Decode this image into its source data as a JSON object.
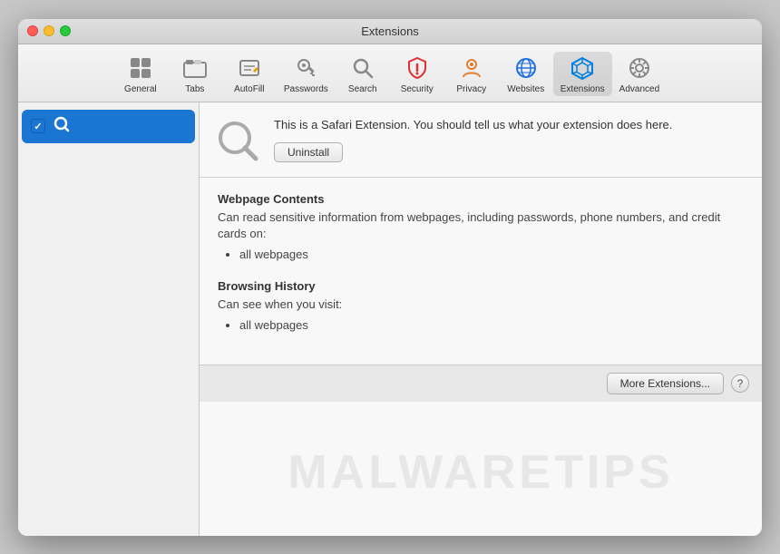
{
  "window": {
    "title": "Extensions"
  },
  "toolbar": {
    "items": [
      {
        "id": "general",
        "label": "General",
        "icon": "general"
      },
      {
        "id": "tabs",
        "label": "Tabs",
        "icon": "tabs"
      },
      {
        "id": "autofill",
        "label": "AutoFill",
        "icon": "autofill"
      },
      {
        "id": "passwords",
        "label": "Passwords",
        "icon": "passwords"
      },
      {
        "id": "search",
        "label": "Search",
        "icon": "search"
      },
      {
        "id": "security",
        "label": "Security",
        "icon": "security"
      },
      {
        "id": "privacy",
        "label": "Privacy",
        "icon": "privacy"
      },
      {
        "id": "websites",
        "label": "Websites",
        "icon": "websites"
      },
      {
        "id": "extensions",
        "label": "Extensions",
        "icon": "extensions",
        "active": true
      },
      {
        "id": "advanced",
        "label": "Advanced",
        "icon": "advanced"
      }
    ]
  },
  "sidebar": {
    "items": [
      {
        "id": "search-ext",
        "label": "",
        "checked": true,
        "selected": true
      }
    ]
  },
  "extension": {
    "description": "This is a Safari Extension. You should tell us what your extension does here.",
    "uninstall_label": "Uninstall"
  },
  "permissions": {
    "groups": [
      {
        "title": "Webpage Contents",
        "description": "Can read sensitive information from webpages, including passwords, phone numbers, and credit cards on:",
        "items": [
          "all webpages"
        ]
      },
      {
        "title": "Browsing History",
        "description": "Can see when you visit:",
        "items": [
          "all webpages"
        ]
      }
    ]
  },
  "footer": {
    "more_extensions_label": "More Extensions...",
    "help_label": "?"
  },
  "watermark": {
    "text": "MALWARETIPS"
  }
}
